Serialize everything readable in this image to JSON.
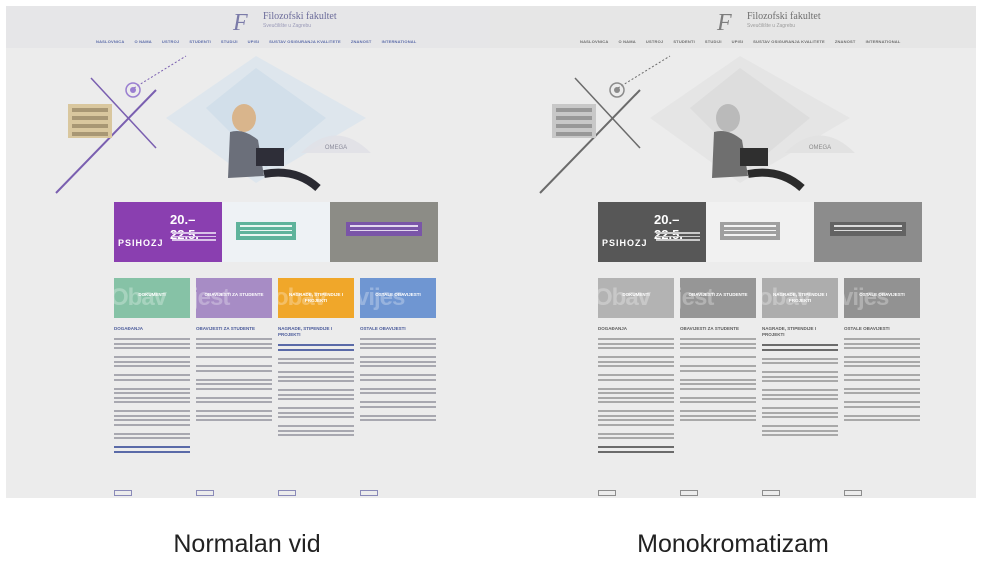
{
  "header": {
    "logo_title": "Filozofski fakultet",
    "logo_subtitle": "Sveučilište u Zagrebu"
  },
  "nav": [
    "NASLOVNICA",
    "O NAMA",
    "USTROJ",
    "STUDENTI",
    "STUDIJI",
    "UPISI",
    "SUSTAV OSIGURANJA KVALITETE",
    "ZNANOST",
    "INTERNATIONAL"
  ],
  "hero": {
    "sign_text": "OMEGA"
  },
  "banners": {
    "b1_date": "20.–22.5.",
    "b1_logo": "PSIHOZJ"
  },
  "tiles": [
    {
      "label": "DOKUMENTI",
      "big": "Obav",
      "color": "#86c2a6"
    },
    {
      "label": "OBAVIJESTI\nZA STUDENTE",
      "big": "jest",
      "color": "#a78cc5"
    },
    {
      "label": "NAGRADE,\nSTIPENDIJE I\nPROJEKTI",
      "big": "obav",
      "color": "#f0a72a"
    },
    {
      "label": "OSTALE OBAVIJESTI",
      "big": "vijes",
      "color": "#6f96d2"
    }
  ],
  "columns": [
    {
      "heading": "DOGAĐANJA"
    },
    {
      "heading": "OBAVIJESTI ZA STUDENTE"
    },
    {
      "heading": "NAGRADE, STIPENDIJE I\nPROJEKTI"
    },
    {
      "heading": "OSTALE OBAVIJESTI"
    }
  ],
  "captions": {
    "left": "Normalan vid",
    "right": "Monokromatizam"
  }
}
